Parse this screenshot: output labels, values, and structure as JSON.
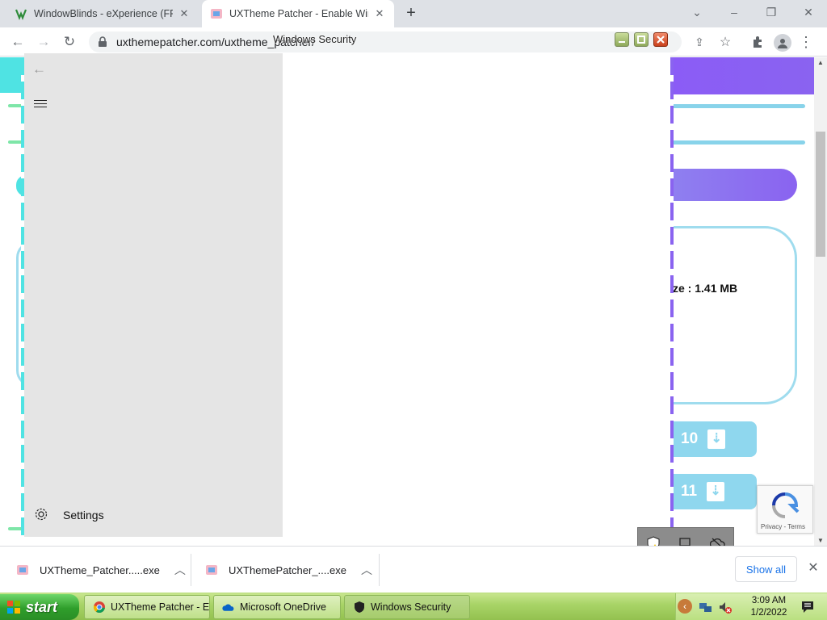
{
  "browser": {
    "tabs": [
      {
        "title": "WindowBlinds - eXperience (FRE",
        "active": false
      },
      {
        "title": "UXTheme Patcher - Enable Wind",
        "active": true
      }
    ],
    "new_tab_icon": "plus-icon",
    "url": "uxthemepatcher.com/uxtheme_patcher/"
  },
  "website": {
    "file_size_text": "ze : 1.41 MB",
    "download_buttons": [
      {
        "label": "10"
      },
      {
        "label": "11"
      }
    ],
    "recaptcha_label": "Privacy - Terms"
  },
  "windows_security": {
    "title": "Windows Security",
    "settings_label": "Settings"
  },
  "downloads": {
    "items": [
      {
        "filename": "UXTheme_Patcher.....exe"
      },
      {
        "filename": "UXThemePatcher_....exe"
      }
    ],
    "show_all_label": "Show all"
  },
  "taskbar": {
    "start_label": "start",
    "tasks": [
      {
        "label": "UXTheme Patcher - E...",
        "icon": "chrome-icon"
      },
      {
        "label": "Microsoft OneDrive",
        "icon": "onedrive-icon"
      },
      {
        "label": "Windows Security",
        "icon": "shield-icon"
      }
    ],
    "clock_time": "3:09 AM",
    "clock_date": "1/2/2022"
  },
  "colors": {
    "cyan_accent": "#4fe3e3",
    "purple_accent": "#8a63f0",
    "light_blue": "#8fd7ee",
    "xp_green": "#a9d468"
  }
}
